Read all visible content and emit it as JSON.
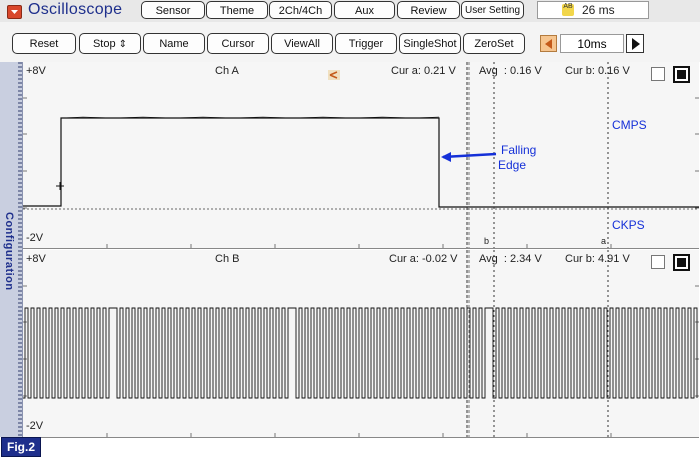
{
  "app": {
    "title": "Oscilloscope",
    "tabs": [
      "Sensor",
      "Theme",
      "2Ch/4Ch",
      "Aux",
      "Review",
      "User Setting"
    ],
    "time_readout": "26 ms",
    "time_badge": "AB"
  },
  "controls": {
    "buttons": [
      "Reset",
      "Stop",
      "Name",
      "Cursor",
      "ViewAll",
      "Trigger",
      "SingleShot",
      "ZeroSet"
    ],
    "stop_arrows": "⇕",
    "timebase": "10ms"
  },
  "sidebar": {
    "label": "Configuration"
  },
  "channel_a": {
    "name": "Ch A",
    "top_scale": "+8V",
    "bottom_scale": "-2V",
    "cur_a": "Cur a: 0.21 V",
    "avg": "Avg  : 0.16 V",
    "cur_b": "Cur b: 0.16 V",
    "trace_label_1": "CMPS",
    "trace_label_2": "CKPS",
    "annotation_line1": "Falling",
    "annotation_line2": "Edge",
    "marker_b": "b",
    "marker_a": "a"
  },
  "channel_b": {
    "name": "Ch B",
    "top_scale": "+8V",
    "bottom_scale": "-2V",
    "cur_a": "Cur a: -0.02 V",
    "avg": "Avg  : 2.34 V",
    "cur_b": "Cur b: 4.91 V"
  },
  "figure_label": "Fig.2",
  "colors": {
    "accent_text": "#1e2f8c",
    "annotation": "#1530d8",
    "sidebar": "#c9cfe0",
    "logo": "#d9472b"
  }
}
